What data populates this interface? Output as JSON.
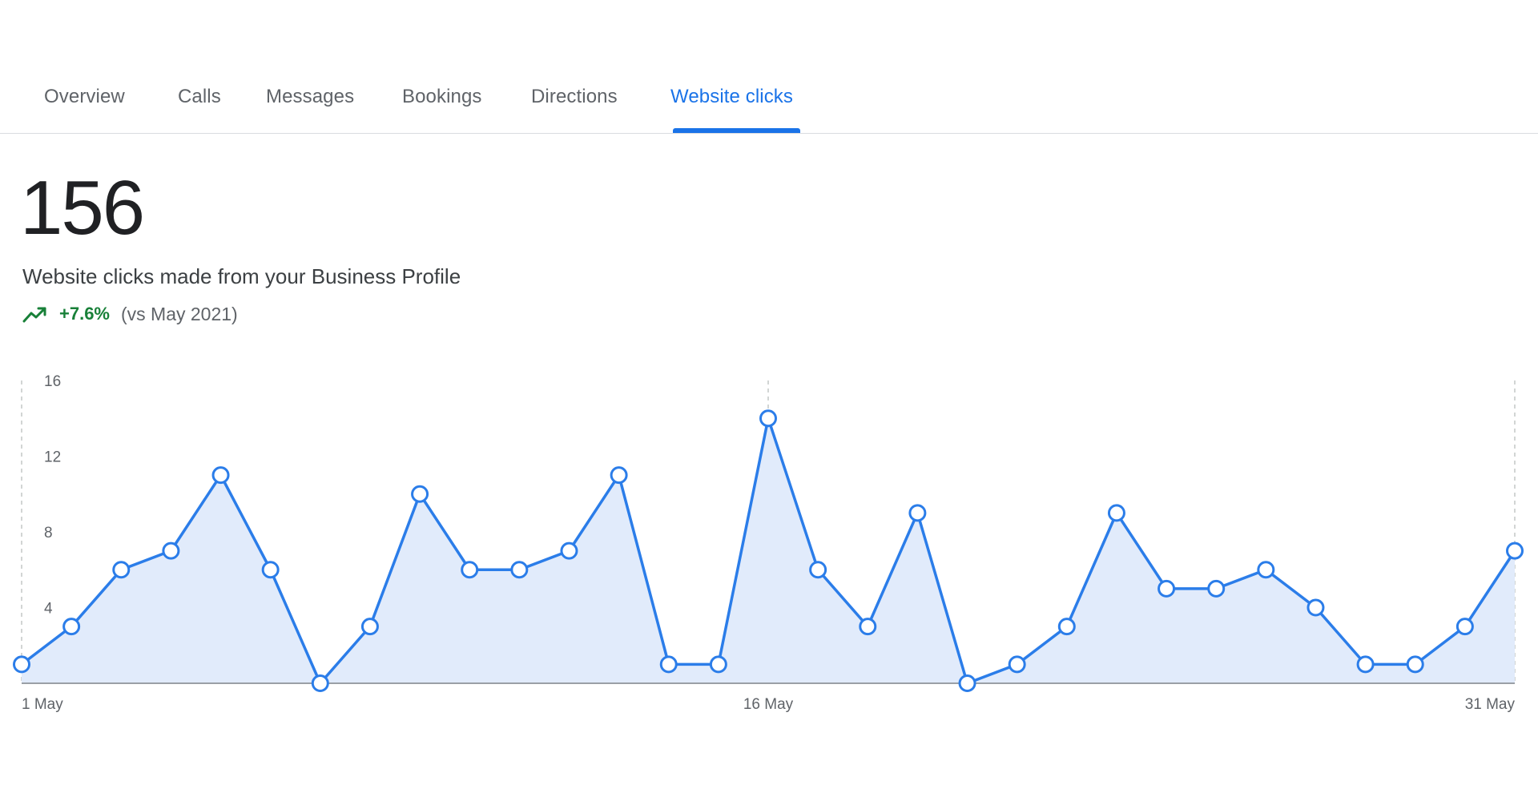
{
  "tabs": [
    {
      "label": "Overview",
      "active": false
    },
    {
      "label": "Calls",
      "active": false
    },
    {
      "label": "Messages",
      "active": false
    },
    {
      "label": "Bookings",
      "active": false
    },
    {
      "label": "Directions",
      "active": false
    },
    {
      "label": "Website clicks",
      "active": true
    }
  ],
  "summary": {
    "total": "156",
    "description": "Website clicks made from your Business Profile",
    "change": "+7.6%",
    "comparison": "(vs May 2021)"
  },
  "colors": {
    "accent": "#1a73e8",
    "line": "#2b7de9",
    "fill": "#e1ebfb",
    "positive": "#188038"
  },
  "icons": {
    "trend": "trending-up-icon"
  },
  "chart_data": {
    "type": "area",
    "x": [
      "1 May",
      "2 May",
      "3 May",
      "4 May",
      "5 May",
      "6 May",
      "7 May",
      "8 May",
      "9 May",
      "10 May",
      "11 May",
      "12 May",
      "13 May",
      "14 May",
      "15 May",
      "16 May",
      "17 May",
      "18 May",
      "19 May",
      "20 May",
      "21 May",
      "22 May",
      "23 May",
      "24 May",
      "25 May",
      "26 May",
      "27 May",
      "28 May",
      "29 May",
      "30 May",
      "31 May"
    ],
    "values": [
      1,
      3,
      6,
      7,
      11,
      6,
      0,
      3,
      10,
      6,
      6,
      7,
      11,
      1,
      1,
      14,
      6,
      3,
      9,
      0,
      1,
      3,
      9,
      5,
      5,
      6,
      4,
      1,
      1,
      3,
      7
    ],
    "x_tick_labels": [
      "1 May",
      "16 May",
      "31 May"
    ],
    "x_tick_indices": [
      0,
      15,
      30
    ],
    "y_ticks": [
      "4",
      "8",
      "12",
      "16"
    ],
    "y_tick_values": [
      4,
      8,
      12,
      16
    ],
    "ylim": [
      0,
      16
    ],
    "grid": "vertical dashed at x ticks",
    "legend": "none"
  }
}
